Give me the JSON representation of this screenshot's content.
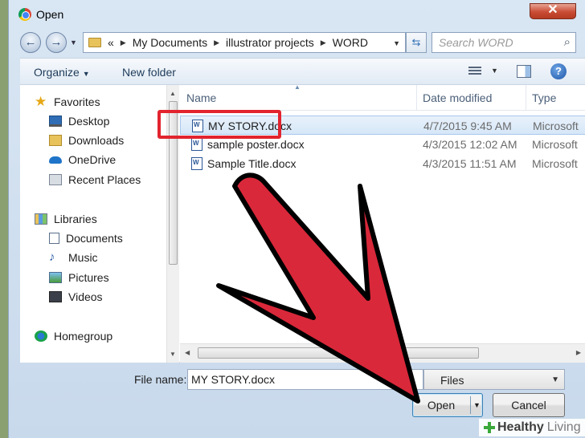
{
  "window": {
    "title": "Open"
  },
  "address": {
    "hist_glyph": "«",
    "crumbs": [
      "My Documents",
      "illustrator projects",
      "WORD"
    ],
    "search_placeholder": "Search WORD"
  },
  "toolbar": {
    "organize": "Organize",
    "new_folder": "New folder"
  },
  "nav": {
    "favorites": "Favorites",
    "desktop": "Desktop",
    "downloads": "Downloads",
    "onedrive": "OneDrive",
    "recent": "Recent Places",
    "libraries": "Libraries",
    "documents": "Documents",
    "music": "Music",
    "pictures": "Pictures",
    "videos": "Videos",
    "homegroup": "Homegroup"
  },
  "columns": {
    "name": "Name",
    "date": "Date modified",
    "type": "Type"
  },
  "files": [
    {
      "name": "MY STORY.docx",
      "date": "4/7/2015 9:45 AM",
      "type": "Microsoft"
    },
    {
      "name": "sample poster.docx",
      "date": "4/3/2015 12:02 AM",
      "type": "Microsoft"
    },
    {
      "name": "Sample Title.docx",
      "date": "4/3/2015 11:51 AM",
      "type": "Microsoft"
    }
  ],
  "footer": {
    "file_name_label": "File name:",
    "file_name_value": "MY STORY.docx",
    "file_type_value": "Files",
    "open": "Open",
    "cancel": "Cancel"
  },
  "watermark": {
    "part1": "Healthy",
    "part2": "Living"
  },
  "colors": {
    "highlight": "#e2242e",
    "arrow": "#d9283a"
  }
}
